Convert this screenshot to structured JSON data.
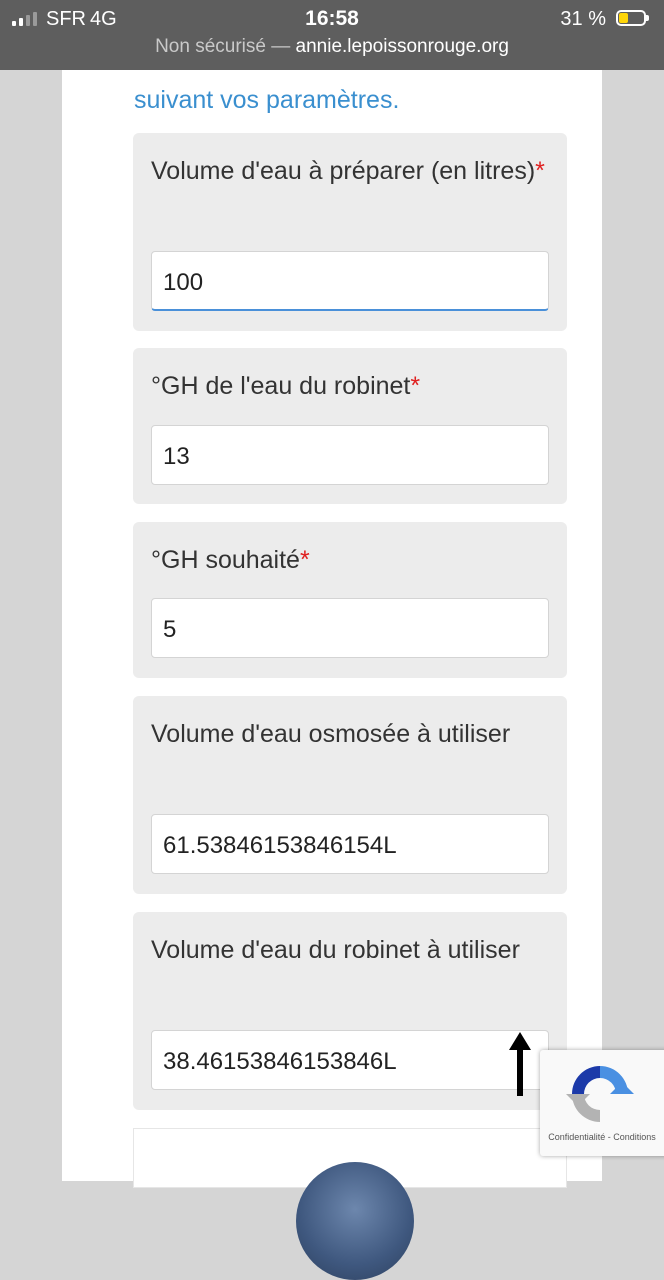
{
  "status_bar": {
    "carrier": "SFR",
    "network": "4G",
    "time": "16:58",
    "battery_percent": "31 %",
    "icons": [
      "signal-icon",
      "battery-icon"
    ]
  },
  "url_bar": {
    "security_label": "Non sécurisé —",
    "domain": "annie.lepoissonrouge.org"
  },
  "page": {
    "intro_text": "suivant vos paramètres.",
    "required_marker": "*",
    "fields": [
      {
        "label": "Volume d'eau à préparer (en litres)",
        "required": true,
        "value": "100"
      },
      {
        "label": "°GH de l'eau du robinet",
        "required": true,
        "value": "13"
      },
      {
        "label": "°GH souhaité",
        "required": true,
        "value": "5"
      },
      {
        "label": "Volume d'eau osmosée à utiliser",
        "required": false,
        "value": "61.53846153846154L"
      },
      {
        "label": "Volume d'eau du robinet à utiliser",
        "required": false,
        "value": "38.46153846153846L"
      }
    ]
  },
  "recaptcha": {
    "links": "Confidentialité - Conditions"
  },
  "colors": {
    "link_blue": "#3a8fcf",
    "required_red": "#e02020",
    "status_bar_bg": "#5e5e5e",
    "battery_yellow": "#ffd60a"
  }
}
